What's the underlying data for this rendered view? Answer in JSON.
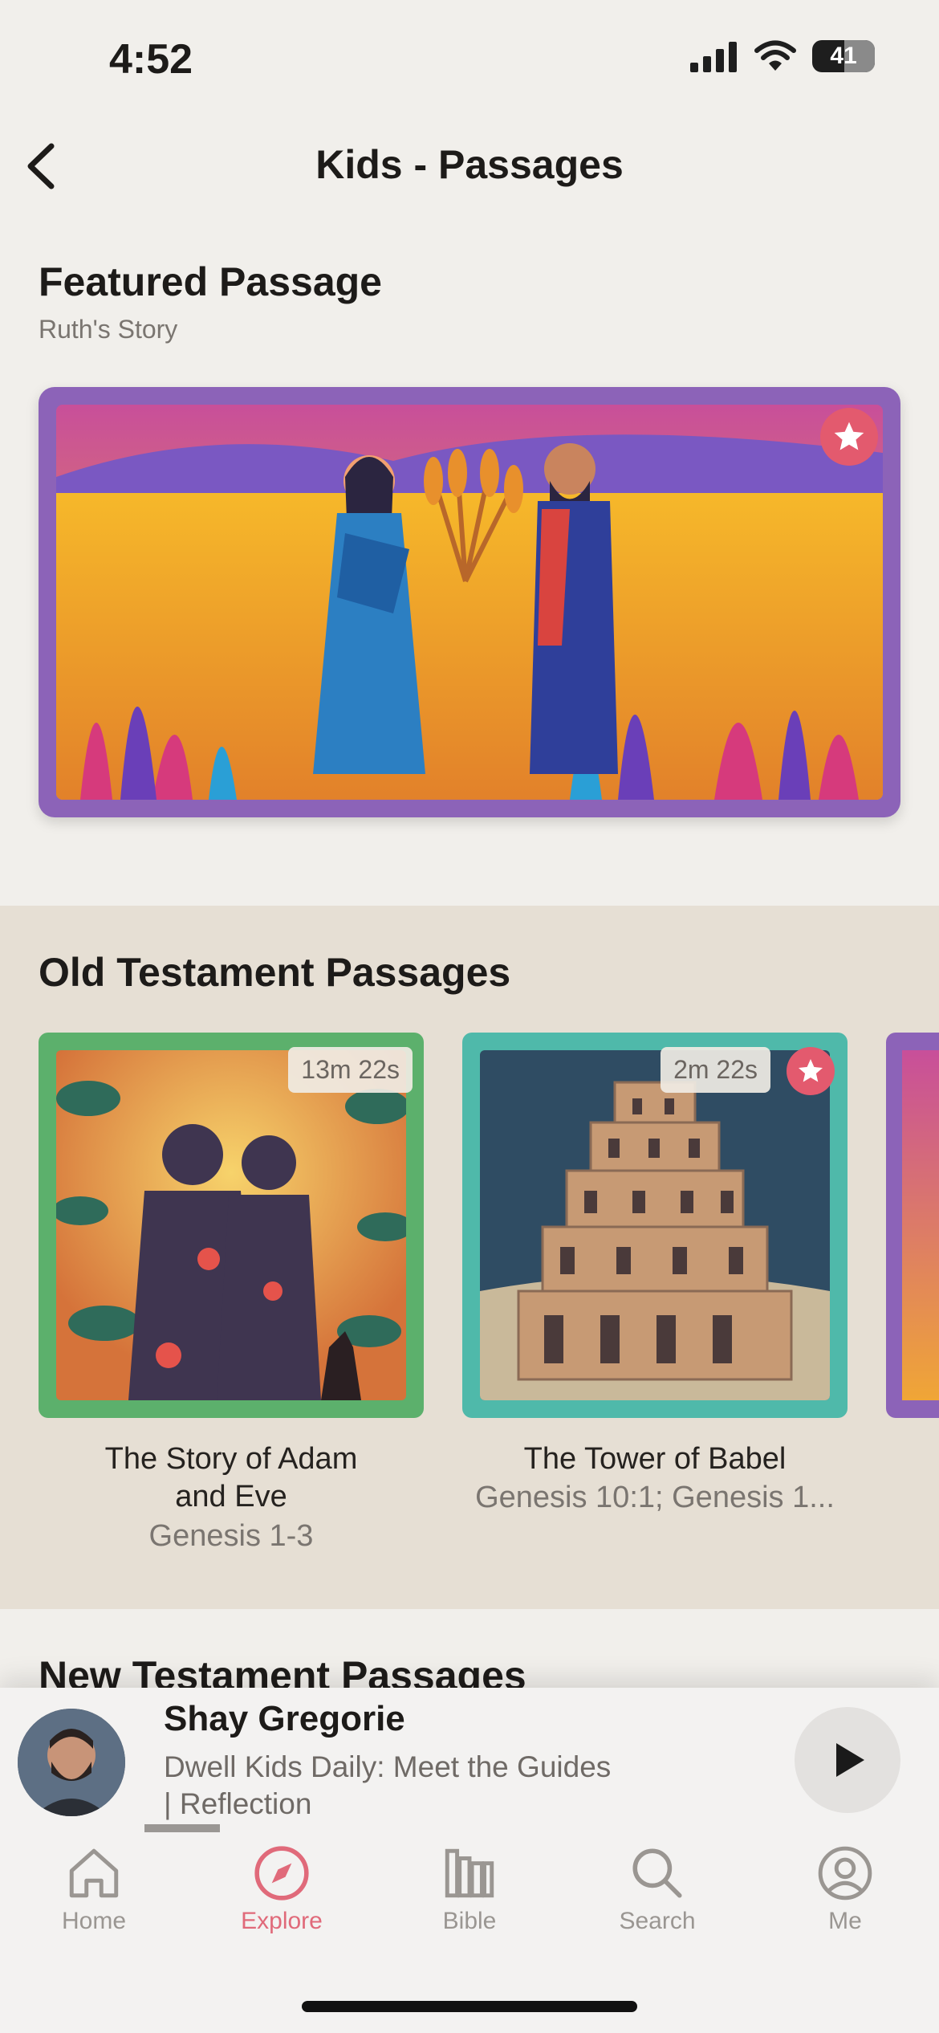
{
  "status_bar": {
    "time": "4:52",
    "battery": "41"
  },
  "nav": {
    "title": "Kids - Passages"
  },
  "featured": {
    "heading": "Featured Passage",
    "subtitle": "Ruth's Story"
  },
  "old_testament": {
    "heading": "Old Testament Passages",
    "items": [
      {
        "title": "The Story of Adam and Eve",
        "title_line1": "The Story of Adam",
        "title_line2": "and Eve",
        "reference": "Genesis 1-3",
        "duration": "13m 22s",
        "frame_color": "#5cb06c"
      },
      {
        "title": "The Tower of Babel",
        "reference": "Genesis 10:1; Genesis 1...",
        "duration": "2m 22s",
        "frame_color": "#4fb9aa"
      }
    ]
  },
  "new_testament": {
    "heading": "New Testament Passages"
  },
  "player": {
    "name": "Shay Gregorie",
    "line1": "Dwell Kids Daily: Meet the Guides",
    "line2": "| Reflection",
    "progress": 0.08
  },
  "tabs": [
    {
      "label": "Home",
      "icon": "home-icon",
      "active": false
    },
    {
      "label": "Explore",
      "icon": "compass-icon",
      "active": true
    },
    {
      "label": "Bible",
      "icon": "bible-icon",
      "active": false
    },
    {
      "label": "Search",
      "icon": "search-icon",
      "active": false
    },
    {
      "label": "Me",
      "icon": "person-icon",
      "active": false
    }
  ],
  "colors": {
    "accent": "#e06a7a",
    "featured_frame": "#8c63b8",
    "section_bg": "#e6dfd4"
  }
}
